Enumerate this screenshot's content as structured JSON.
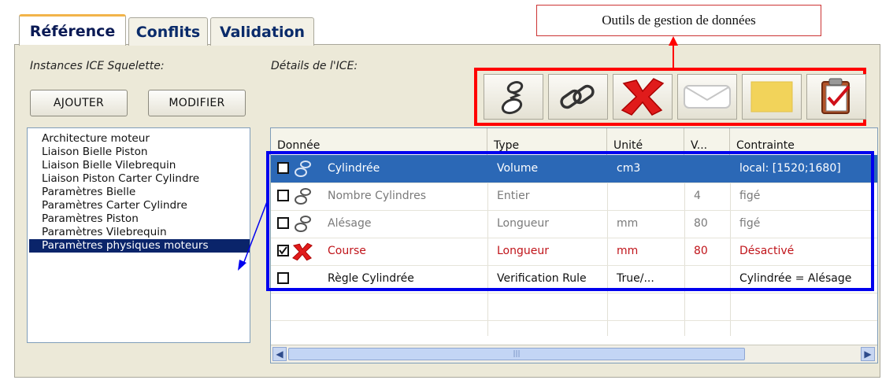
{
  "tabs": [
    {
      "label": "Référence"
    },
    {
      "label": "Conflits"
    },
    {
      "label": "Validation"
    }
  ],
  "annotation": {
    "label": "Outils de gestion de données"
  },
  "left": {
    "caption": "Instances ICE Squelette:",
    "add_label": "AJOUTER",
    "modify_label": "MODIFIER",
    "items": [
      "Architecture moteur",
      "Liaison Bielle Piston",
      "Liaison Bielle Vilebrequin",
      "Liaison Piston Carter Cylindre",
      "Paramètres Bielle",
      "Paramètres Carter Cylindre",
      "Paramètres Piston",
      "Paramètres Vilebrequin",
      "Paramètres physiques moteurs"
    ],
    "selected_index": 8
  },
  "right": {
    "caption": "Détails de l'ICE:"
  },
  "toolbar": {
    "icons": [
      "chain-link-unlinked-icon",
      "chain-link-icon",
      "delete-x-icon",
      "envelope-icon",
      "note-icon",
      "clipboard-check-icon"
    ]
  },
  "table": {
    "columns": [
      "Donnée",
      "Type",
      "Unité",
      "V...",
      "Contrainte"
    ],
    "rows": [
      {
        "checked": false,
        "name": "Cylindrée",
        "type": "Volume",
        "unit": "cm3",
        "value": "",
        "constraint": "local: [1520;1680]",
        "state": "selected"
      },
      {
        "checked": false,
        "name": "Nombre Cylindres",
        "type": "Entier",
        "unit": "",
        "value": "4",
        "constraint": "figé",
        "state": "grey"
      },
      {
        "checked": false,
        "name": "Alésage",
        "type": "Longueur",
        "unit": "mm",
        "value": "80",
        "constraint": "figé",
        "state": "grey"
      },
      {
        "checked": true,
        "name": "Course",
        "type": "Longueur",
        "unit": "mm",
        "value": "80",
        "constraint": "Désactivé",
        "state": "active"
      },
      {
        "checked": false,
        "name": "Règle Cylindrée",
        "type": "Verification Rule",
        "unit": "True/...",
        "value": "",
        "constraint": "Cylindrée = Alésage",
        "state": "rule"
      }
    ]
  },
  "colors": {
    "annotation_red": "#ff0000",
    "annotation_blue": "#0000ee",
    "selection": "#2b68b6",
    "list_selection": "#0a246a"
  }
}
